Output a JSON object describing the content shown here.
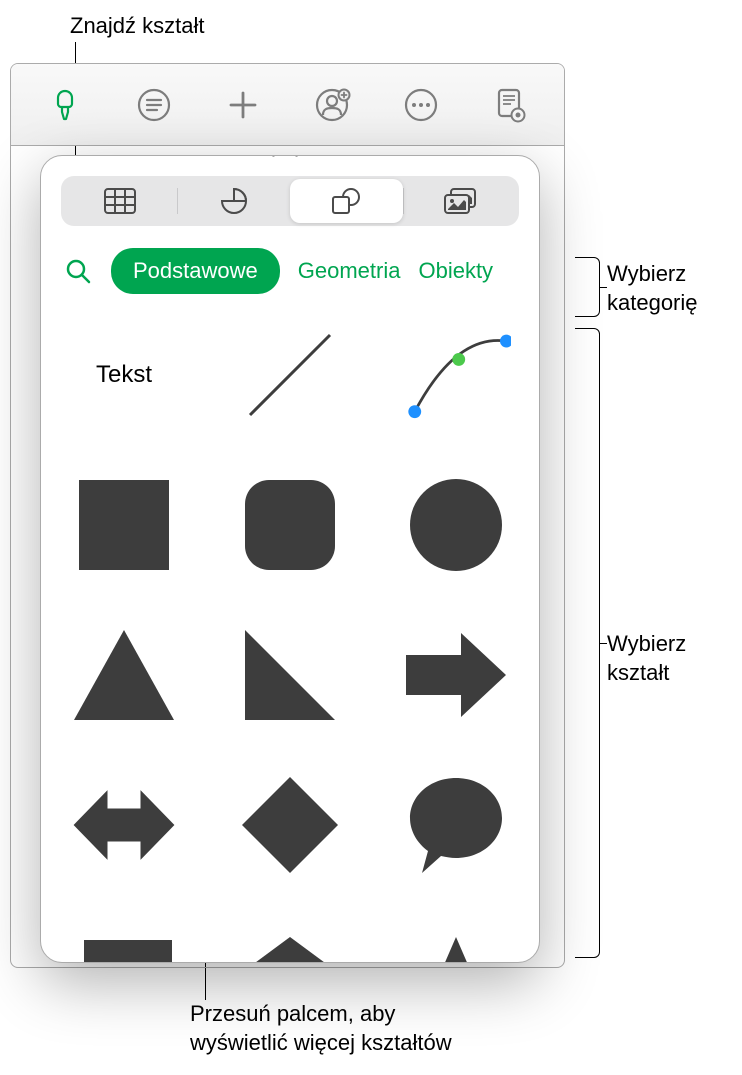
{
  "callouts": {
    "find": "Znajdź kształt",
    "category": "Wybierz\nkategorię",
    "shape": "Wybierz\nkształt",
    "swipe": "Przesuń palcem, aby\nwyświetlić więcej kształtów"
  },
  "toolbar": {
    "format_icon": "format-brush-icon",
    "list_icon": "list-icon",
    "insert_icon": "plus-icon",
    "collaborate_icon": "collaborate-icon",
    "more_icon": "more-ellipsis-icon",
    "document_icon": "document-view-icon"
  },
  "segmented": {
    "table": "table-icon",
    "chart": "chart-pie-icon",
    "shape": "shapes-icon",
    "media": "media-icon"
  },
  "categories": {
    "search": "search-icon",
    "items": [
      "Podstawowe",
      "Geometria",
      "Obiekty"
    ],
    "active_index": 0
  },
  "shapes": {
    "text_label": "Tekst",
    "items": [
      "text",
      "line",
      "curve",
      "square",
      "rounded-square",
      "circle",
      "triangle",
      "right-triangle",
      "arrow-right",
      "arrow-bidirectional",
      "diamond",
      "speech-bubble",
      "callout-rect",
      "pentagon",
      "star"
    ]
  },
  "colors": {
    "accent": "#00a550",
    "shape_fill": "#3d3d3d"
  }
}
